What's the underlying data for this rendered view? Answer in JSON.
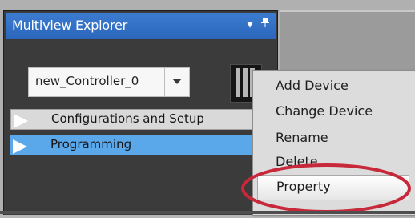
{
  "explorer": {
    "title": "Multiview Explorer",
    "dropdown_caret": "▾",
    "pin_icon": "pin-icon"
  },
  "device_selector": {
    "value": "new_Controller_0"
  },
  "tree": {
    "items": [
      {
        "label": "Configurations and Setup",
        "selected": false
      },
      {
        "label": "Programming",
        "selected": true
      }
    ]
  },
  "context_menu": {
    "items": [
      {
        "label": "Add Device"
      },
      {
        "label": "Change Device"
      },
      {
        "label": "Rename"
      },
      {
        "label": "Delete"
      },
      {
        "label": "Property",
        "highlighted": true
      }
    ]
  },
  "colors": {
    "title_bar": "#2b66bb",
    "selected_row": "#5aa7ea",
    "highlight_ellipse": "#c7283a"
  }
}
